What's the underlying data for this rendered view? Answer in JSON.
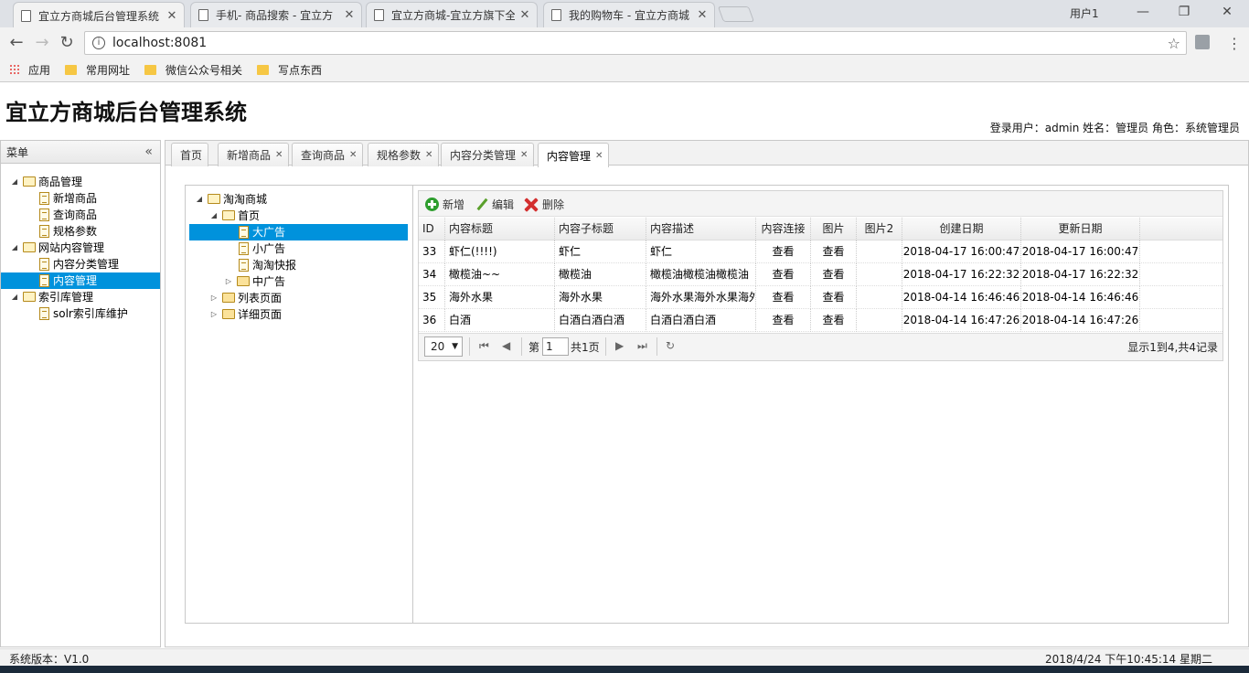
{
  "browser": {
    "tabs": [
      {
        "title": "宜立方商城后台管理系统",
        "active": true
      },
      {
        "title": "手机- 商品搜索 - 宜立方",
        "active": false
      },
      {
        "title": "宜立方商城-宜立方旗下全",
        "active": false
      },
      {
        "title": "我的购物车 - 宜立方商城",
        "active": false
      }
    ],
    "window_user": "用户1",
    "url": "localhost:8081",
    "bookmarks": [
      "应用",
      "常用网址",
      "微信公众号相关",
      "写点东西"
    ]
  },
  "app": {
    "title": "宜立方商城后台管理系统",
    "user_info": "登录用户：admin  姓名：管理员  角色：系统管理员",
    "status_version": "系统版本：V1.0",
    "status_clock": "2018/4/24 下午10:45:14 星期二"
  },
  "menu": {
    "title": "菜单",
    "nodes": [
      {
        "label": "商品管理",
        "type": "folder-open",
        "depth": 0,
        "toggle": "expanded",
        "selected": false
      },
      {
        "label": "新增商品",
        "type": "doc",
        "depth": 1,
        "selected": false
      },
      {
        "label": "查询商品",
        "type": "doc",
        "depth": 1,
        "selected": false
      },
      {
        "label": "规格参数",
        "type": "doc",
        "depth": 1,
        "selected": false
      },
      {
        "label": "网站内容管理",
        "type": "folder-open",
        "depth": 0,
        "toggle": "expanded",
        "selected": false
      },
      {
        "label": "内容分类管理",
        "type": "doc",
        "depth": 1,
        "selected": false
      },
      {
        "label": "内容管理",
        "type": "doc",
        "depth": 1,
        "selected": true
      },
      {
        "label": "索引库管理",
        "type": "folder-open",
        "depth": 0,
        "toggle": "expanded",
        "selected": false
      },
      {
        "label": "solr索引库维护",
        "type": "doc",
        "depth": 1,
        "selected": false
      }
    ]
  },
  "page_tabs": [
    {
      "label": "首页",
      "closable": false,
      "active": false
    },
    {
      "label": "新增商品",
      "closable": true,
      "active": false
    },
    {
      "label": "查询商品",
      "closable": true,
      "active": false
    },
    {
      "label": "规格参数",
      "closable": true,
      "active": false
    },
    {
      "label": "内容分类管理",
      "closable": true,
      "active": false
    },
    {
      "label": "内容管理",
      "closable": true,
      "active": true
    }
  ],
  "content_tree": [
    {
      "label": "淘淘商城",
      "type": "folder-open",
      "depth": 0,
      "toggle": "expanded",
      "selected": false
    },
    {
      "label": "首页",
      "type": "folder-open",
      "depth": 1,
      "toggle": "expanded",
      "selected": false
    },
    {
      "label": "大广告",
      "type": "doc",
      "depth": 2,
      "selected": true
    },
    {
      "label": "小广告",
      "type": "doc",
      "depth": 2,
      "selected": false
    },
    {
      "label": "淘淘快报",
      "type": "doc",
      "depth": 2,
      "selected": false
    },
    {
      "label": "中广告",
      "type": "folder",
      "depth": 2,
      "toggle": "collapsed",
      "selected": false
    },
    {
      "label": "列表页面",
      "type": "folder",
      "depth": 1,
      "toggle": "collapsed",
      "selected": false
    },
    {
      "label": "详细页面",
      "type": "folder",
      "depth": 1,
      "toggle": "collapsed",
      "selected": false
    }
  ],
  "toolbar": {
    "add_label": "新增",
    "edit_label": "编辑",
    "delete_label": "删除"
  },
  "grid": {
    "columns": [
      "ID",
      "内容标题",
      "内容子标题",
      "内容描述",
      "内容连接",
      "图片",
      "图片2",
      "创建日期",
      "更新日期"
    ],
    "rows": [
      [
        "33",
        "虾仁(!!!!)",
        "虾仁",
        "虾仁",
        "查看",
        "查看",
        "",
        "2018-04-17 16:00:47",
        "2018-04-17 16:00:47"
      ],
      [
        "34",
        "橄榄油~~",
        "橄榄油",
        "橄榄油橄榄油橄榄油",
        "查看",
        "查看",
        "",
        "2018-04-17 16:22:32",
        "2018-04-17 16:22:32"
      ],
      [
        "35",
        "海外水果",
        "海外水果",
        "海外水果海外水果海外",
        "查看",
        "查看",
        "",
        "2018-04-14 16:46:46",
        "2018-04-14 16:46:46"
      ],
      [
        "36",
        "白酒",
        "白酒白酒白酒",
        "白酒白酒白酒",
        "查看",
        "查看",
        "",
        "2018-04-14 16:47:26",
        "2018-04-14 16:47:26"
      ]
    ]
  },
  "pager": {
    "page_size": "20",
    "page_prefix": "第",
    "page_number": "1",
    "page_total": "共1页",
    "summary": "显示1到4,共4记录"
  }
}
